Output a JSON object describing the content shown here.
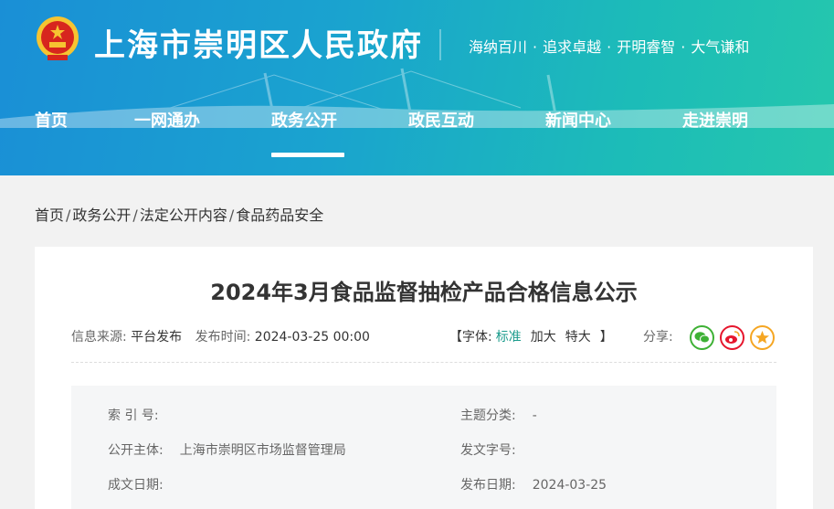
{
  "header": {
    "site_title": "上海市崇明区人民政府",
    "slogan": [
      "海纳百川",
      "追求卓越",
      "开明睿智",
      "大气谦和"
    ],
    "slogan_separator": "·",
    "nav": [
      {
        "label": "首页"
      },
      {
        "label": "一网通办"
      },
      {
        "label": "政务公开",
        "active": true
      },
      {
        "label": "政民互动"
      },
      {
        "label": "新闻中心"
      },
      {
        "label": "走进崇明"
      }
    ],
    "colors": {
      "gradient_start": "#1a8fd6",
      "gradient_end": "#25c7ad"
    }
  },
  "breadcrumb": [
    "首页",
    "政务公开",
    "法定公开内容",
    "食品药品安全"
  ],
  "breadcrumb_separator": "/",
  "article": {
    "title": "2024年3月食品监督抽检产品合格信息公示",
    "source_label": "信息来源:",
    "source_value": "平台发布",
    "time_label": "发布时间:",
    "time_value": "2024-03-25 00:00",
    "font_size": {
      "open": "【",
      "label": "字体:",
      "options": [
        "标准",
        "加大",
        "特大"
      ],
      "close": "】"
    },
    "share_label": "分享:",
    "share_icons": [
      "wechat-icon",
      "weibo-icon",
      "star-icon"
    ]
  },
  "info": {
    "index_label": "索  引  号:",
    "index_value": "",
    "category_label": "主题分类:",
    "category_value": "-",
    "publisher_label": "公开主体:",
    "publisher_value": "上海市崇明区市场监督管理局",
    "doc_no_label": "发文字号:",
    "doc_no_value": "",
    "written_date_label": "成文日期:",
    "written_date_value": "",
    "publish_date_label": "发布日期:",
    "publish_date_value": "2024-03-25"
  }
}
